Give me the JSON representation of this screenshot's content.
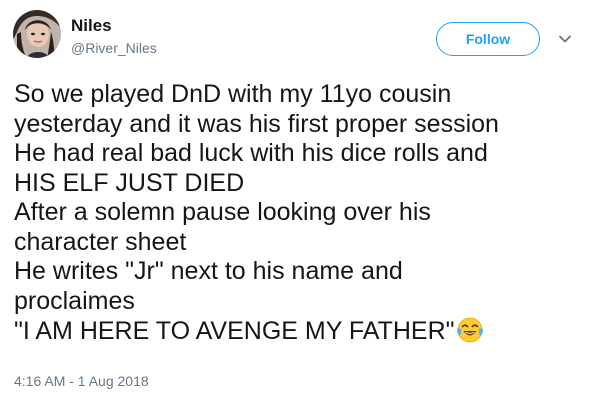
{
  "author": {
    "display_name": "Niles",
    "handle": "@River_Niles"
  },
  "actions": {
    "follow_label": "Follow"
  },
  "tweet": {
    "lines": [
      "So we played DnD with my 11yo cousin",
      "yesterday and it was his first proper session",
      "He had real bad luck with his dice rolls and",
      "HIS ELF JUST DIED",
      "After a solemn pause looking over his",
      "character sheet",
      "He writes \"Jr\" next to his name and",
      "proclaimes",
      "\"I AM HERE TO AVENGE MY FATHER\""
    ],
    "emoji": "face-with-tears-of-joy",
    "timestamp": "4:16 AM - 1 Aug 2018"
  },
  "colors": {
    "accent": "#1da1f2",
    "text": "#14171a",
    "muted": "#657786"
  },
  "icons": {
    "caret": "chevron-down-icon",
    "avatar": "avatar"
  }
}
